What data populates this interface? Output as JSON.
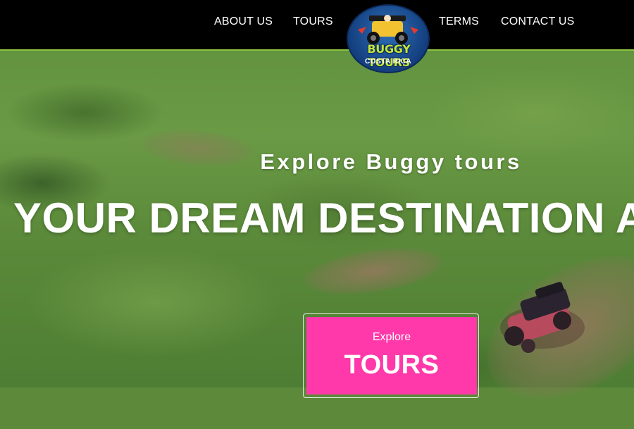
{
  "header": {
    "nav": [
      {
        "label": "ABOUT US"
      },
      {
        "label": "TOURS"
      },
      {
        "label": "TERMS"
      },
      {
        "label": "CONTACT US"
      }
    ],
    "logo": {
      "title": "BUGGY TOURS",
      "subtitle": "COSTA RICA"
    }
  },
  "hero": {
    "subtitle": "Explore Buggy tours",
    "headline": "YOUR DREAM DESTINATION A",
    "cta": {
      "small_label": "Explore",
      "big_label": "TOURS"
    }
  },
  "colors": {
    "header_bg": "#000000",
    "header_accent": "#8cc63f",
    "cta_bg": "#ff39a9",
    "text": "#ffffff"
  }
}
